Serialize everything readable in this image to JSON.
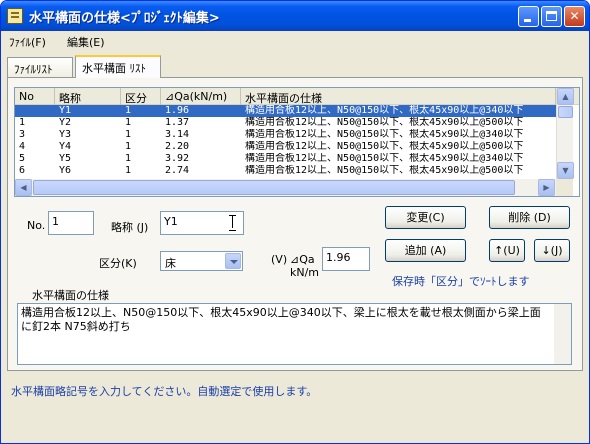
{
  "window": {
    "title": "水平構面の仕様<ﾌﾟﾛｼﾞｪｸﾄ編集>"
  },
  "menu": {
    "file": "ﾌｧｲﾙ(F)",
    "edit": "編集(E)"
  },
  "tabs": [
    {
      "label": "ﾌｧｲﾙﾘｽﾄ"
    },
    {
      "label": "水平構面 ﾘｽﾄ"
    }
  ],
  "list": {
    "columns": [
      "No",
      "略称",
      "区分",
      "⊿Qa(kN/m)",
      "水平構面の仕様"
    ],
    "rows": [
      {
        "no": "",
        "abbr": "Y1",
        "kind": "1",
        "qa": "1.96",
        "spec": "構造用合板12以上、N50@150以下、根太45x90以上@340以下"
      },
      {
        "no": "1",
        "abbr": "Y2",
        "kind": "1",
        "qa": "1.37",
        "spec": "構造用合板12以上、N50@150以下、根太45x90以上@500以下"
      },
      {
        "no": "3",
        "abbr": "Y3",
        "kind": "1",
        "qa": "3.14",
        "spec": "構造用合板12以上、N50@150以下、根太45x90以上@340以下"
      },
      {
        "no": "4",
        "abbr": "Y4",
        "kind": "1",
        "qa": "2.20",
        "spec": "構造用合板12以上、N50@150以下、根太45x90以上@500以下"
      },
      {
        "no": "5",
        "abbr": "Y5",
        "kind": "1",
        "qa": "3.92",
        "spec": "構造用合板12以上、N50@150以下、根太45x90以上@340以下"
      },
      {
        "no": "6",
        "abbr": "Y6",
        "kind": "1",
        "qa": "2.74",
        "spec": "構造用合板12以上、N50@150以下、根太45x90以上@500以下"
      }
    ]
  },
  "form": {
    "no_label": "No.",
    "no_value": "1",
    "abbr_label": "略称 (J)",
    "abbr_value": "Y1",
    "kind_label": "区分(K)",
    "kind_value": "床",
    "qa_label_v": "(V)",
    "qa_label_text": "⊿Qa",
    "qa_unit": "kN/m",
    "qa_value": "1.96",
    "spec_label": "水平構面の仕様",
    "spec_text": "構造用合板12以上、N50@150以下、根太45x90以上@340以下、梁上に根太を載せ根太側面から梁上面に釘2本 N75斜め打ち"
  },
  "buttons": {
    "change": "変更(C)",
    "delete": "削除 (D)",
    "add": "追加 (A)",
    "up": "↑(U)",
    "down": "↓(J)"
  },
  "sort_note": "保存時「区分」でｿｰﾄします",
  "status": "水平構面略記号を入力してください。自動選定で使用します。"
}
